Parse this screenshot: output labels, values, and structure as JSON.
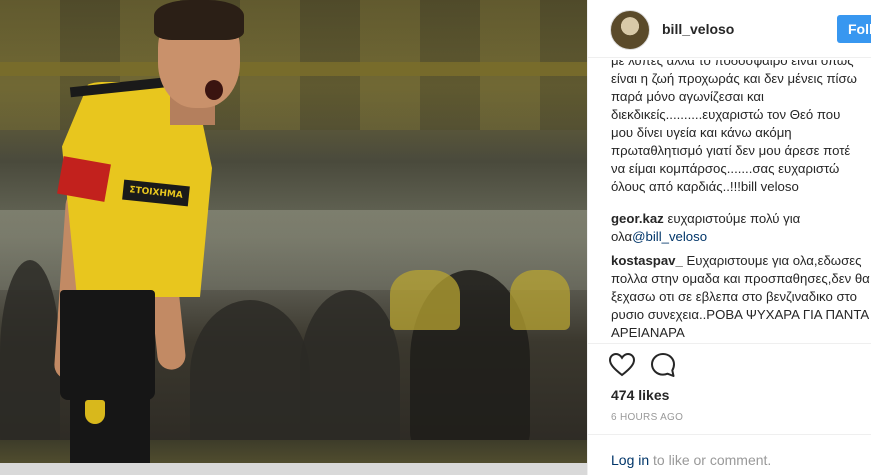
{
  "post": {
    "username": "bill_veloso",
    "follow_label": "Follow",
    "caption": "με λύπες αλλά το ποδόσφαιρο είναι όπως\nείναι η ζωή προχωράς και δεν μένεις πίσω\nπαρά μόνο αγωνίζεσαι και\nδιεκδικείς..........ευχαριστώ τον Θεό που\nμου δίνει υγεία και κάνω ακόμη\nπρωταθλητισμό γιατί δεν μου άρεσε ποτέ\nνα είμαι κομπάρσος.......σας ευχαριστώ\nόλους από καρδιάς..!!!bill veloso",
    "sponsor_text": "ΣΤΟΙΧΗΜΑ",
    "comments": [
      {
        "author": "geor.kaz",
        "text": " ευχαριστούμε πολύ για ολα",
        "mention": "@bill_veloso"
      },
      {
        "author": "kostaspav_",
        "text": " Ευχαριστουμε για ολα,εδωσες πολλα στην ομαδα και προσπαθησες,δεν θα ξεχασω οτι σε εβλεπα στο βενζιναδικο στο ρυσιο συνεχεια..ΡΟΒΑ ΨΥΧΑΡΑ ΓΙΑ ΠΑΝΤΑ ΑΡΕΙΑΝΑΡΑ"
      }
    ],
    "likes": "474 likes",
    "timestamp": "6 HOURS AGO",
    "login": {
      "link": "Log in",
      "rest": " to like or comment."
    }
  },
  "icons": {
    "like": "heart-icon",
    "comment": "comment-bubble-icon"
  },
  "colors": {
    "follow_button": "#3897f0",
    "link": "#003569",
    "muted": "#999999",
    "jersey": "#e8c61e"
  }
}
